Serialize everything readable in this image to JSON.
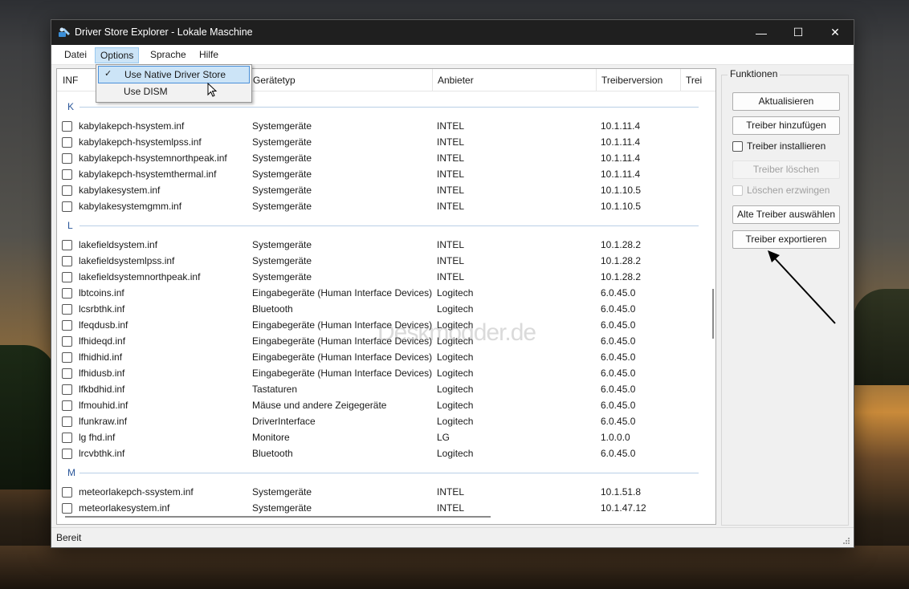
{
  "window": {
    "title": "Driver Store Explorer - Lokale Maschine"
  },
  "window_controls": {
    "minimize": "—",
    "maximize": "☐",
    "close": "✕"
  },
  "menubar": {
    "items": [
      "Datei",
      "Options",
      "Sprache",
      "Hilfe"
    ],
    "open_menu": "Options"
  },
  "options_menu": {
    "items": [
      {
        "label": "Use Native Driver Store",
        "checked": true,
        "highlighted": true
      },
      {
        "label": "Use DISM",
        "checked": false,
        "highlighted": false
      }
    ],
    "check_glyph": "✓"
  },
  "table": {
    "columns": [
      "INF",
      "Gerätetyp",
      "Anbieter",
      "Treiberversion",
      "Trei"
    ],
    "groups": [
      {
        "letter": "K",
        "rows": [
          [
            "kabylakepch-hsystem.inf",
            "Systemgeräte",
            "INTEL",
            "10.1.11.4"
          ],
          [
            "kabylakepch-hsystemlpss.inf",
            "Systemgeräte",
            "INTEL",
            "10.1.11.4"
          ],
          [
            "kabylakepch-hsystemnorthpeak.inf",
            "Systemgeräte",
            "INTEL",
            "10.1.11.4"
          ],
          [
            "kabylakepch-hsystemthermal.inf",
            "Systemgeräte",
            "INTEL",
            "10.1.11.4"
          ],
          [
            "kabylakesystem.inf",
            "Systemgeräte",
            "INTEL",
            "10.1.10.5"
          ],
          [
            "kabylakesystemgmm.inf",
            "Systemgeräte",
            "INTEL",
            "10.1.10.5"
          ]
        ]
      },
      {
        "letter": "L",
        "rows": [
          [
            "lakefieldsystem.inf",
            "Systemgeräte",
            "INTEL",
            "10.1.28.2"
          ],
          [
            "lakefieldsystemlpss.inf",
            "Systemgeräte",
            "INTEL",
            "10.1.28.2"
          ],
          [
            "lakefieldsystemnorthpeak.inf",
            "Systemgeräte",
            "INTEL",
            "10.1.28.2"
          ],
          [
            "lbtcoins.inf",
            "Eingabegeräte (Human Interface Devices)",
            "Logitech",
            "6.0.45.0"
          ],
          [
            "lcsrbthk.inf",
            "Bluetooth",
            "Logitech",
            "6.0.45.0"
          ],
          [
            "lfeqdusb.inf",
            "Eingabegeräte (Human Interface Devices)",
            "Logitech",
            "6.0.45.0"
          ],
          [
            "lfhideqd.inf",
            "Eingabegeräte (Human Interface Devices)",
            "Logitech",
            "6.0.45.0"
          ],
          [
            "lfhidhid.inf",
            "Eingabegeräte (Human Interface Devices)",
            "Logitech",
            "6.0.45.0"
          ],
          [
            "lfhidusb.inf",
            "Eingabegeräte (Human Interface Devices)",
            "Logitech",
            "6.0.45.0"
          ],
          [
            "lfkbdhid.inf",
            "Tastaturen",
            "Logitech",
            "6.0.45.0"
          ],
          [
            "lfmouhid.inf",
            "Mäuse und andere Zeigegeräte",
            "Logitech",
            "6.0.45.0"
          ],
          [
            "lfunkraw.inf",
            "DriverInterface",
            "Logitech",
            "6.0.45.0"
          ],
          [
            "lg fhd.inf",
            "Monitore",
            "LG",
            "1.0.0.0"
          ],
          [
            "lrcvbthk.inf",
            "Bluetooth",
            "Logitech",
            "6.0.45.0"
          ]
        ]
      },
      {
        "letter": "M",
        "rows": [
          [
            "meteorlakepch-ssystem.inf",
            "Systemgeräte",
            "INTEL",
            "10.1.51.8"
          ],
          [
            "meteorlakesystem.inf",
            "Systemgeräte",
            "INTEL",
            "10.1.47.12"
          ]
        ]
      }
    ]
  },
  "functions": {
    "title": "Funktionen",
    "refresh": "Aktualisieren",
    "add_driver": "Treiber hinzufügen",
    "install_driver": "Treiber installieren",
    "delete_driver": "Treiber löschen",
    "force_delete": "Löschen erzwingen",
    "select_old": "Alte Treiber auswählen",
    "export_drivers": "Treiber exportieren"
  },
  "status": {
    "text": "Bereit"
  },
  "watermark": {
    "text": "Deskmodder.de"
  },
  "colors": {
    "group_letter": "#2b579a",
    "menu_highlight": "#cce4f7",
    "titlebar": "#1f1f1f"
  }
}
